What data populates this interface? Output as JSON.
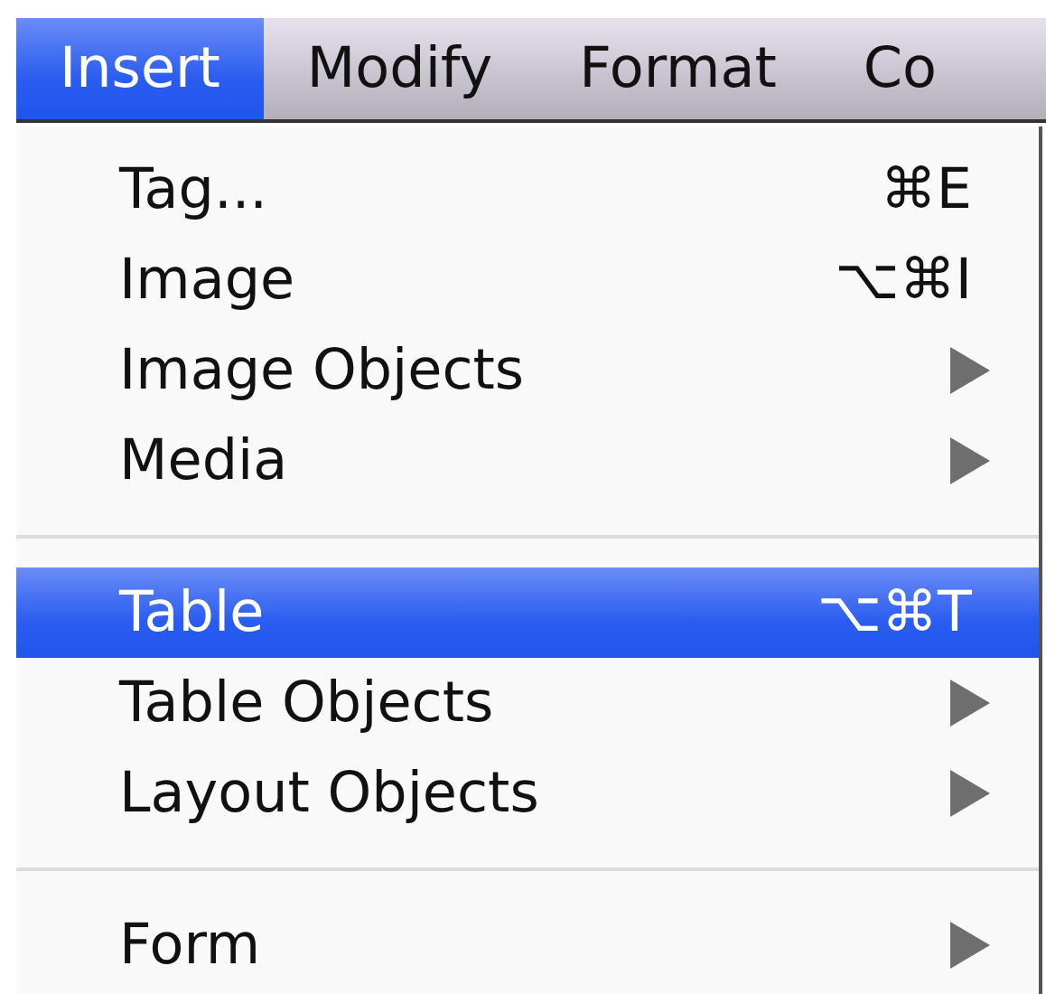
{
  "menu_bar": [
    {
      "label": "Insert",
      "selected": true
    },
    {
      "label": "Modify",
      "selected": false
    },
    {
      "label": "Format",
      "selected": false
    },
    {
      "label": "Co",
      "selected": false
    }
  ],
  "menu": [
    {
      "kind": "item",
      "label": "Tag...",
      "shortcut": "⌘E",
      "submenu": false,
      "selected": false
    },
    {
      "kind": "item",
      "label": "Image",
      "shortcut": "⌥⌘I",
      "submenu": false,
      "selected": false
    },
    {
      "kind": "item",
      "label": "Image Objects",
      "submenu": true,
      "selected": false
    },
    {
      "kind": "item",
      "label": "Media",
      "submenu": true,
      "selected": false
    },
    {
      "kind": "separator"
    },
    {
      "kind": "item",
      "label": "Table",
      "shortcut": "⌥⌘T",
      "submenu": false,
      "selected": true
    },
    {
      "kind": "item",
      "label": "Table Objects",
      "submenu": true,
      "selected": false
    },
    {
      "kind": "item",
      "label": "Layout Objects",
      "submenu": true,
      "selected": false
    },
    {
      "kind": "separator"
    },
    {
      "kind": "item",
      "label": "Form",
      "submenu": true,
      "selected": false
    }
  ]
}
